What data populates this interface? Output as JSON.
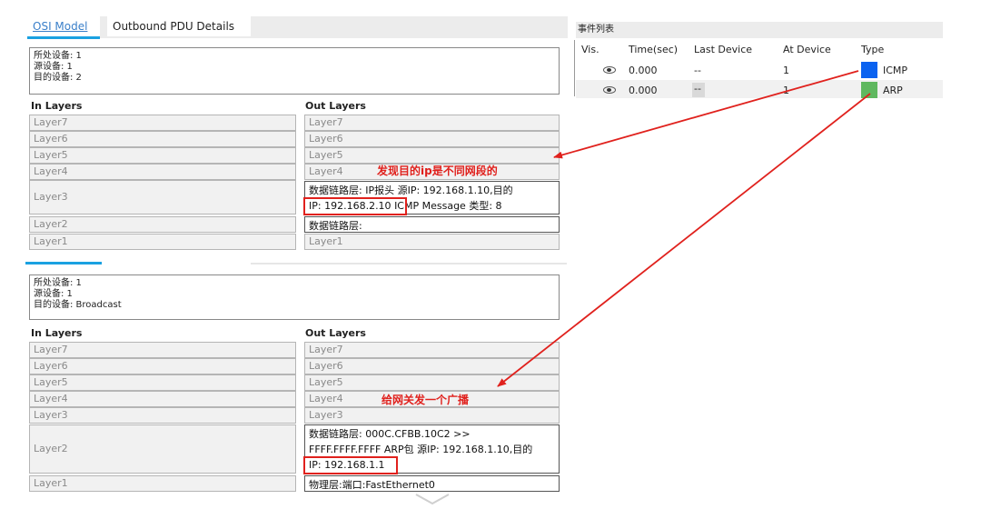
{
  "tabs": [
    {
      "label": "OSI Model",
      "active": true
    },
    {
      "label": "Outbound PDU Details",
      "active": false
    }
  ],
  "pdu1": {
    "info": [
      "所处设备: 1",
      "源设备: 1",
      "目的设备: 2"
    ],
    "in_header": "In Layers",
    "out_header": "Out Layers",
    "in_layers": [
      "Layer7",
      "Layer6",
      "Layer5",
      "Layer4",
      "Layer3",
      "Layer2",
      "Layer1"
    ],
    "out_layers": [
      "Layer7",
      "Layer6",
      "Layer5",
      "Layer4"
    ],
    "out_l3": [
      "数据链路层: IP报头 源IP: 192.168.1.10,目的",
      "IP: 192.168.2.10",
      "ICMP Message 类型: 8"
    ],
    "out_l2": "数据链路层:",
    "out_l1": "Layer1"
  },
  "pdu2": {
    "info": [
      "所处设备: 1",
      "源设备: 1",
      "目的设备: Broadcast"
    ],
    "in_header": "In Layers",
    "out_header": "Out Layers",
    "in_layers": [
      "Layer7",
      "Layer6",
      "Layer5",
      "Layer4",
      "Layer3",
      "Layer2",
      "Layer1"
    ],
    "out_layers": [
      "Layer7",
      "Layer6",
      "Layer5",
      "Layer4",
      "Layer3"
    ],
    "out_l2": [
      "数据链路层: 000C.CFBB.10C2 >>",
      "FFFF.FFFF.FFFF ARP包 源IP: 192.168.1.10,目的",
      "IP: 192.168.1.1"
    ],
    "out_l1": "物理层:端口:FastEthernet0"
  },
  "events": {
    "title": "事件列表",
    "headers": [
      "Vis.",
      "Time(sec)",
      "Last Device",
      "At Device",
      "Type"
    ],
    "rows": [
      {
        "vis": "eye-icon",
        "time": "0.000",
        "last": "--",
        "at": "1",
        "type": "ICMP",
        "color": "#0a62f0"
      },
      {
        "vis": "eye-icon",
        "time": "0.000",
        "last": "--",
        "at": "1",
        "type": "ARP",
        "color": "#5fb85f"
      }
    ]
  },
  "annotations": {
    "a1": "发现目的ip是不同网段的",
    "a2": "给网关发一个广播"
  },
  "colors": {
    "accent": "#1aa1e1",
    "highlight": "#e0211d",
    "icmp": "#0a62f0",
    "arp": "#5fb85f"
  }
}
